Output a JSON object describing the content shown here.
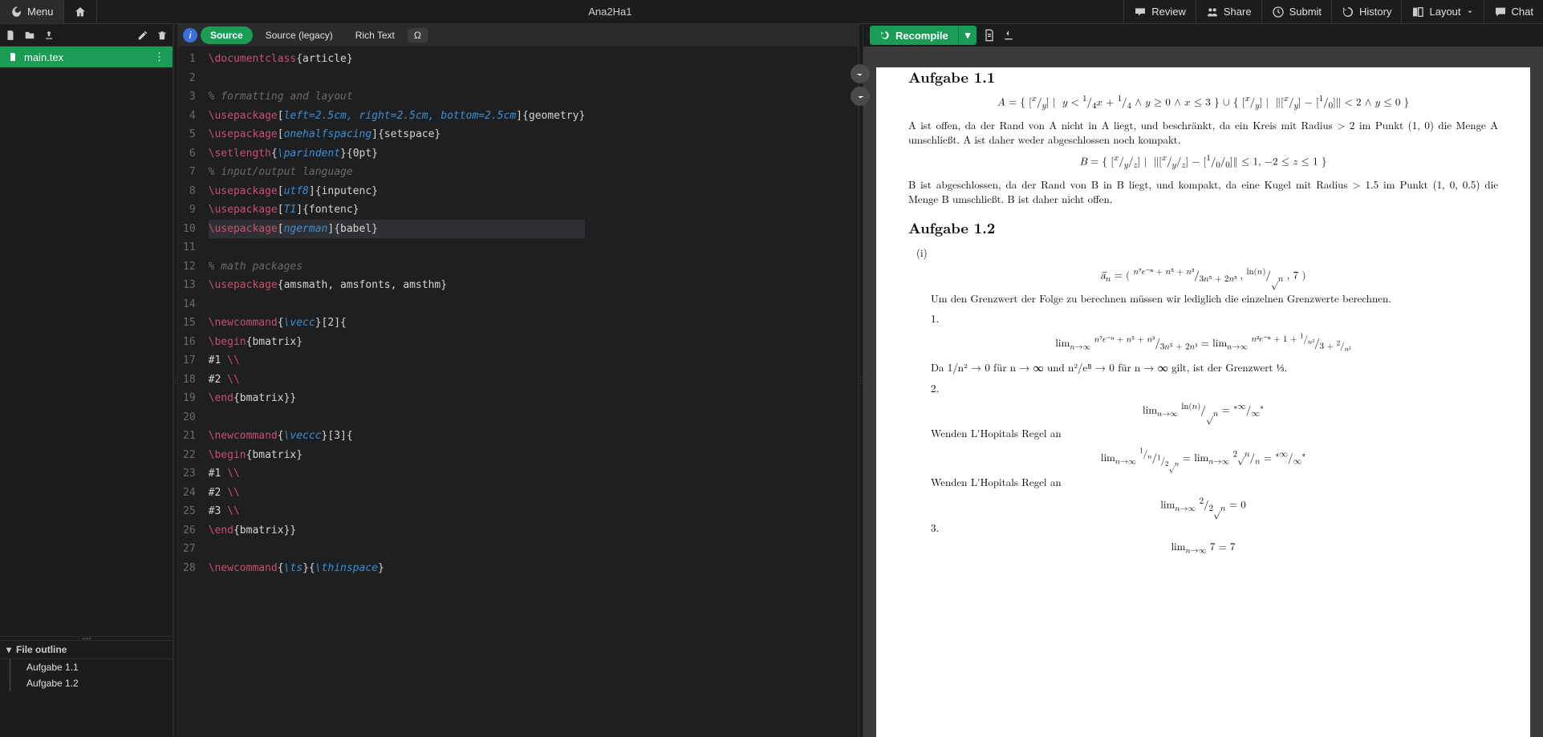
{
  "topbar": {
    "menu": "Menu",
    "project_title": "Ana2Ha1",
    "review": "Review",
    "share": "Share",
    "submit": "Submit",
    "history": "History",
    "layout": "Layout",
    "chat": "Chat"
  },
  "filepanel": {
    "file_name": "main.tex",
    "outline_header": "File outline",
    "outline_items": [
      "Aufgabe 1.1",
      "Aufgabe 1.2"
    ]
  },
  "editor": {
    "tabs": {
      "source": "Source",
      "source_legacy": "Source (legacy)",
      "rich_text": "Rich Text",
      "omega": "Ω"
    },
    "lines": [
      {
        "n": 1,
        "segs": [
          {
            "c": "tok-cmd",
            "t": "\\documentclass"
          },
          {
            "c": "tok-grp",
            "t": "{article}"
          }
        ]
      },
      {
        "n": 2,
        "segs": []
      },
      {
        "n": 3,
        "segs": [
          {
            "c": "tok-cmt",
            "t": "% formatting and layout"
          }
        ]
      },
      {
        "n": 4,
        "segs": [
          {
            "c": "tok-cmd",
            "t": "\\usepackage"
          },
          {
            "c": "tok-grp",
            "t": "["
          },
          {
            "c": "tok-opt",
            "t": "left=2.5cm, right=2.5cm, bottom=2.5cm"
          },
          {
            "c": "tok-grp",
            "t": "]{geometry}"
          }
        ]
      },
      {
        "n": 5,
        "segs": [
          {
            "c": "tok-cmd",
            "t": "\\usepackage"
          },
          {
            "c": "tok-grp",
            "t": "["
          },
          {
            "c": "tok-opt",
            "t": "onehalfspacing"
          },
          {
            "c": "tok-grp",
            "t": "]{setspace}"
          }
        ]
      },
      {
        "n": 6,
        "segs": [
          {
            "c": "tok-cmd",
            "t": "\\setlength"
          },
          {
            "c": "tok-grp",
            "t": "{"
          },
          {
            "c": "tok-opt",
            "t": "\\parindent"
          },
          {
            "c": "tok-grp",
            "t": "}{0pt}"
          }
        ]
      },
      {
        "n": 7,
        "segs": [
          {
            "c": "tok-cmt",
            "t": "% input/output language"
          }
        ]
      },
      {
        "n": 8,
        "segs": [
          {
            "c": "tok-cmd",
            "t": "\\usepackage"
          },
          {
            "c": "tok-grp",
            "t": "["
          },
          {
            "c": "tok-opt",
            "t": "utf8"
          },
          {
            "c": "tok-grp",
            "t": "]{inputenc}"
          }
        ]
      },
      {
        "n": 9,
        "segs": [
          {
            "c": "tok-cmd",
            "t": "\\usepackage"
          },
          {
            "c": "tok-grp",
            "t": "["
          },
          {
            "c": "tok-opt",
            "t": "T1"
          },
          {
            "c": "tok-grp",
            "t": "]{fontenc}"
          }
        ]
      },
      {
        "n": 10,
        "active": true,
        "segs": [
          {
            "c": "tok-cmd",
            "t": "\\usepackage"
          },
          {
            "c": "tok-grp",
            "t": "["
          },
          {
            "c": "tok-opt",
            "t": "ngerman"
          },
          {
            "c": "tok-grp",
            "t": "]{babel}"
          }
        ]
      },
      {
        "n": 11,
        "segs": []
      },
      {
        "n": 12,
        "segs": [
          {
            "c": "tok-cmt",
            "t": "% math packages"
          }
        ]
      },
      {
        "n": 13,
        "segs": [
          {
            "c": "tok-cmd",
            "t": "\\usepackage"
          },
          {
            "c": "tok-grp",
            "t": "{amsmath, amsfonts, amsthm}"
          }
        ]
      },
      {
        "n": 14,
        "segs": []
      },
      {
        "n": 15,
        "segs": [
          {
            "c": "tok-cmd",
            "t": "\\newcommand"
          },
          {
            "c": "tok-grp",
            "t": "{"
          },
          {
            "c": "tok-opt",
            "t": "\\vecc"
          },
          {
            "c": "tok-grp",
            "t": "}[2]{"
          }
        ]
      },
      {
        "n": 16,
        "segs": [
          {
            "c": "tok-cmd",
            "t": "\\begin"
          },
          {
            "c": "tok-grp",
            "t": "{bmatrix}"
          }
        ]
      },
      {
        "n": 17,
        "segs": [
          {
            "c": "tok-grp",
            "t": "#1 "
          },
          {
            "c": "tok-cmd",
            "t": "\\\\"
          }
        ]
      },
      {
        "n": 18,
        "segs": [
          {
            "c": "tok-grp",
            "t": "#2 "
          },
          {
            "c": "tok-cmd",
            "t": "\\\\"
          }
        ]
      },
      {
        "n": 19,
        "segs": [
          {
            "c": "tok-cmd",
            "t": "\\end"
          },
          {
            "c": "tok-grp",
            "t": "{bmatrix}}"
          }
        ]
      },
      {
        "n": 20,
        "segs": []
      },
      {
        "n": 21,
        "segs": [
          {
            "c": "tok-cmd",
            "t": "\\newcommand"
          },
          {
            "c": "tok-grp",
            "t": "{"
          },
          {
            "c": "tok-opt",
            "t": "\\veccc"
          },
          {
            "c": "tok-grp",
            "t": "}[3]{"
          }
        ]
      },
      {
        "n": 22,
        "segs": [
          {
            "c": "tok-cmd",
            "t": "\\begin"
          },
          {
            "c": "tok-grp",
            "t": "{bmatrix}"
          }
        ]
      },
      {
        "n": 23,
        "segs": [
          {
            "c": "tok-grp",
            "t": "#1 "
          },
          {
            "c": "tok-cmd",
            "t": "\\\\"
          }
        ]
      },
      {
        "n": 24,
        "segs": [
          {
            "c": "tok-grp",
            "t": "#2 "
          },
          {
            "c": "tok-cmd",
            "t": "\\\\"
          }
        ]
      },
      {
        "n": 25,
        "segs": [
          {
            "c": "tok-grp",
            "t": "#3 "
          },
          {
            "c": "tok-cmd",
            "t": "\\\\"
          }
        ]
      },
      {
        "n": 26,
        "segs": [
          {
            "c": "tok-cmd",
            "t": "\\end"
          },
          {
            "c": "tok-grp",
            "t": "{bmatrix}}"
          }
        ]
      },
      {
        "n": 27,
        "segs": []
      },
      {
        "n": 28,
        "segs": [
          {
            "c": "tok-cmd",
            "t": "\\newcommand"
          },
          {
            "c": "tok-grp",
            "t": "{"
          },
          {
            "c": "tok-opt",
            "t": "\\ts"
          },
          {
            "c": "tok-grp",
            "t": "}{"
          },
          {
            "c": "tok-opt",
            "t": "\\thinspace"
          },
          {
            "c": "tok-grp",
            "t": "}"
          }
        ]
      }
    ]
  },
  "preview": {
    "recompile": "Recompile",
    "sections": {
      "s11": "Aufgabe 1.1",
      "s12": "Aufgabe 1.2"
    },
    "math": {
      "A_def": "A = { [x;y] | y < ¼x + ¼ ∧ y ≥ 0 ∧ x ≤ 3 } ∪ { [x;y] | ∥[x;y] − [1;0]∥ < 2 ∧ y ≤ 0 }",
      "A_text": "A ist offen, da der Rand von A nicht in A liegt, und beschränkt, da ein Kreis mit Radius > 2 im Punkt (1, 0) die Menge A umschließt. A ist daher weder abgeschlossen noch kompakt.",
      "B_def": "B = { [x;y;z] | ∥[x;y;z] − [1;0;0]∥ ≤ 1, −2 ≤ z ≤ 1 }",
      "B_text": "B ist abgeschlossen, da der Rand von B in B liegt, und kompakt, da eine Kugel mit Radius > 1.5 im Punkt (1, 0, 0.5) die Menge B umschließt. B ist daher nicht offen.",
      "i_label": "(i)",
      "an_def": "a⃗ₙ = ( (n⁷e⁻ⁿ + n⁵ + n³)/(3n⁵ + 2n³), ln(n)/√n, 7 )",
      "gw_intro": "Um den Grenzwert der Folge zu berechnen müssen wir lediglich die einzelnen Grenzwerte berechnen.",
      "n1": "1.",
      "lim1": "limₙ→∞ (n⁷e⁻ⁿ + n⁵ + n³)/(3n⁵ + 2n³) = limₙ→∞ (n²e⁻ⁿ + 1 + 1/n²)/(3 + 2/n²)",
      "lim1_text": "Da 1/n² → 0 für n → ∞ und n²/eⁿ → 0 für n → ∞ gilt, ist der Grenzwert ⅓.",
      "n2": "2.",
      "lim2": "limₙ→∞ ln(n)/√n = \"∞/∞\"",
      "lhop": "Wenden L'Hopitals Regel an",
      "lim2b": "limₙ→∞ (1/n)/(1/(2√n)) = limₙ→∞ 2√n/n = \"∞/∞\"",
      "lim2c": "limₙ→∞ 2/(2√n) = 0",
      "n3": "3.",
      "lim3": "limₙ→∞ 7 = 7"
    }
  }
}
